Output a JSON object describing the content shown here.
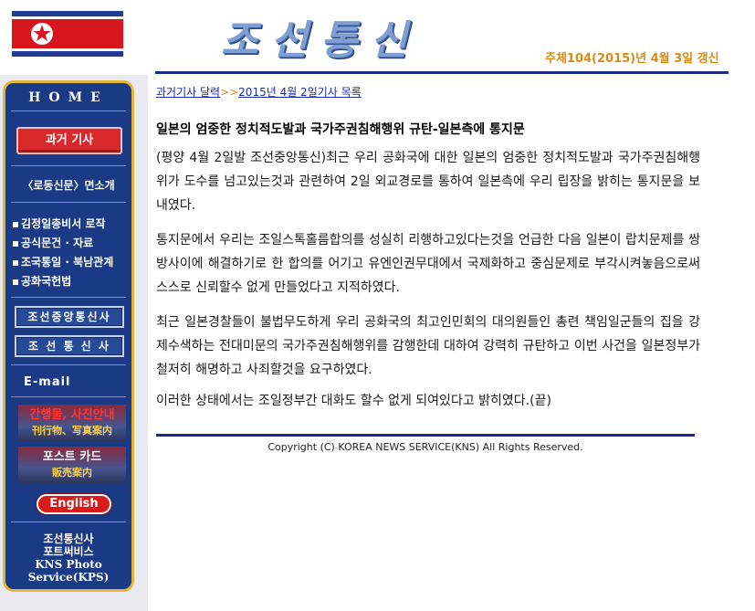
{
  "header": {
    "title": "조선통신",
    "update_text": "주체104(2015)년 4월 3일 갱신",
    "flag_icon": "dprk-flag-icon"
  },
  "sidebar": {
    "home": "HOME",
    "past_articles": "과거 기사",
    "rodong_intro": "〈로동신문〉면소개",
    "menu": [
      "김정일총비서 로작",
      "공식문건 · 자료",
      "조국통일 · 북남관계",
      "공화국헌법"
    ],
    "kcna_button": "조선중앙통신사",
    "kns_button": "조 선 통 신 사",
    "email": "E-mail",
    "promo1_line1": "간행물, 사진안내",
    "promo1_line2": "刊行物、写真案内",
    "promo2_line1": "포스트 카드",
    "promo2_line2": "販売案内",
    "english": "English",
    "kps_lines": [
      "조선통신사",
      "포트써비스",
      "KNS Photo",
      "Service(KPS)"
    ]
  },
  "breadcrumb": {
    "link1": "과거기사 달력",
    "arrow": ">>",
    "link2": "2015년 4월 2일기사 목록"
  },
  "article": {
    "headline": "일본의 엄중한 정치적도발과 국가주권침해행위 규탄-일본측에 통지문",
    "paragraphs": [
      "(평양 4월 2일발 조선중앙통신)최근 우리 공화국에 대한 일본의 엄중한 정치적도발과 국가주권침해행위가 도수를 넘고있는것과 관련하여 2일 외교경로를 통하여 일본측에 우리 립장을 밝히는 통지문을 보내였다.",
      "통지문에서 우리는 조일스톡홀름합의를 성실히 리행하고있다는것을 언급한 다음 일본이 랍치문제를 쌍방사이에 해결하기로 한 합의를 어기고 유엔인권무대에서 국제화하고 중심문제로 부각시켜놓음으로써 스스로 신뢰할수 없게 만들었다고 지적하였다.",
      "최근 일본경찰들이 불법무도하게 우리 공화국의 최고인민회의 대의원들인 총련 책임일군들의 집을 강제수색하는 전대미문의 국가주권침해행위를 감행한데 대하여 강력히 규탄하고 이번 사건을 일본정부가 철저히 해명하고 사죄할것을 요구하였다.",
      "이러한 상태에서는 조일정부간 대화도 할수 없게 되여있다고 밝히였다.(끝)"
    ]
  },
  "footer": {
    "copyright": "Copyright (C) KOREA NEWS SERVICE(KNS) All Rights Reserved."
  },
  "colors": {
    "sidebar_bg": "#1a3a86",
    "sidebar_border": "#e2b53a",
    "rule": "#1a2a8a",
    "update_text": "#d78b10",
    "link": "#1a2ab0"
  }
}
